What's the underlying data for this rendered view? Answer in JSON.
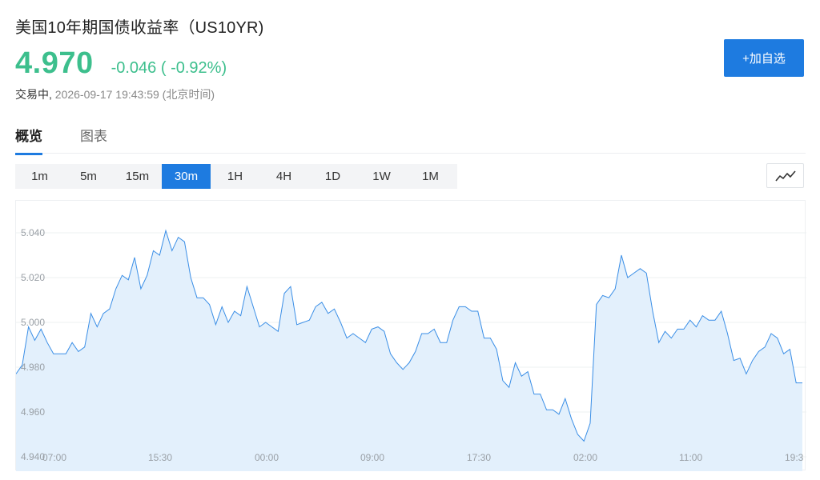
{
  "header": {
    "title": "美国10年期国债收益率（US10YR)",
    "price": "4.970",
    "change": "-0.046 ( -0.92%)",
    "status": "交易中,",
    "timestamp": "2026-09-17 19:43:59 (北京时间)",
    "watch_button": "+加自选"
  },
  "tabs": [
    {
      "label": "概览",
      "active": true
    },
    {
      "label": "图表",
      "active": false
    }
  ],
  "intervals": [
    {
      "label": "1m",
      "active": false
    },
    {
      "label": "5m",
      "active": false
    },
    {
      "label": "15m",
      "active": false
    },
    {
      "label": "30m",
      "active": true
    },
    {
      "label": "1H",
      "active": false
    },
    {
      "label": "4H",
      "active": false
    },
    {
      "label": "1D",
      "active": false
    },
    {
      "label": "1W",
      "active": false
    },
    {
      "label": "1M",
      "active": false
    }
  ],
  "chart_type_icon": "line-chart-icon",
  "colors": {
    "accent": "#1e7be0",
    "up_green": "#3dbf8d",
    "line": "#3a8ee6",
    "area": "#e3f0fc"
  },
  "chart_data": {
    "type": "area",
    "ylim": [
      4.94,
      5.05
    ],
    "y_ticks": [
      "5.040",
      "5.020",
      "5.000",
      "4.980",
      "4.960",
      "4.940"
    ],
    "x_ticks": [
      "07:00",
      "15:30",
      "00:00",
      "09:00",
      "17:30",
      "02:00",
      "11:00",
      "19:3"
    ],
    "grid": true,
    "values": [
      4.977,
      4.981,
      4.998,
      4.992,
      4.997,
      4.991,
      4.986,
      4.986,
      4.986,
      4.991,
      4.987,
      4.989,
      5.004,
      4.998,
      5.004,
      5.006,
      5.015,
      5.021,
      5.019,
      5.029,
      5.015,
      5.021,
      5.032,
      5.03,
      5.041,
      5.032,
      5.038,
      5.036,
      5.02,
      5.011,
      5.011,
      5.008,
      4.999,
      5.007,
      5.0,
      5.005,
      5.003,
      5.016,
      5.007,
      4.998,
      5.0,
      4.998,
      4.996,
      5.013,
      5.016,
      4.999,
      5.0,
      5.001,
      5.007,
      5.009,
      5.004,
      5.006,
      5.0,
      4.993,
      4.995,
      4.993,
      4.991,
      4.997,
      4.998,
      4.996,
      4.986,
      4.982,
      4.979,
      4.982,
      4.987,
      4.995,
      4.995,
      4.997,
      4.991,
      4.991,
      5.001,
      5.007,
      5.007,
      5.005,
      5.005,
      4.993,
      4.993,
      4.988,
      4.974,
      4.971,
      4.982,
      4.976,
      4.978,
      4.968,
      4.968,
      4.961,
      4.961,
      4.959,
      4.966,
      4.957,
      4.95,
      4.947,
      4.955,
      5.008,
      5.012,
      5.011,
      5.015,
      5.03,
      5.02,
      5.022,
      5.024,
      5.022,
      5.005,
      4.991,
      4.996,
      4.993,
      4.997,
      4.997,
      5.001,
      4.998,
      5.003,
      5.001,
      5.001,
      5.005,
      4.995,
      4.983,
      4.984,
      4.977,
      4.983,
      4.987,
      4.989,
      4.995,
      4.993,
      4.986,
      4.988,
      4.973,
      4.973
    ]
  }
}
